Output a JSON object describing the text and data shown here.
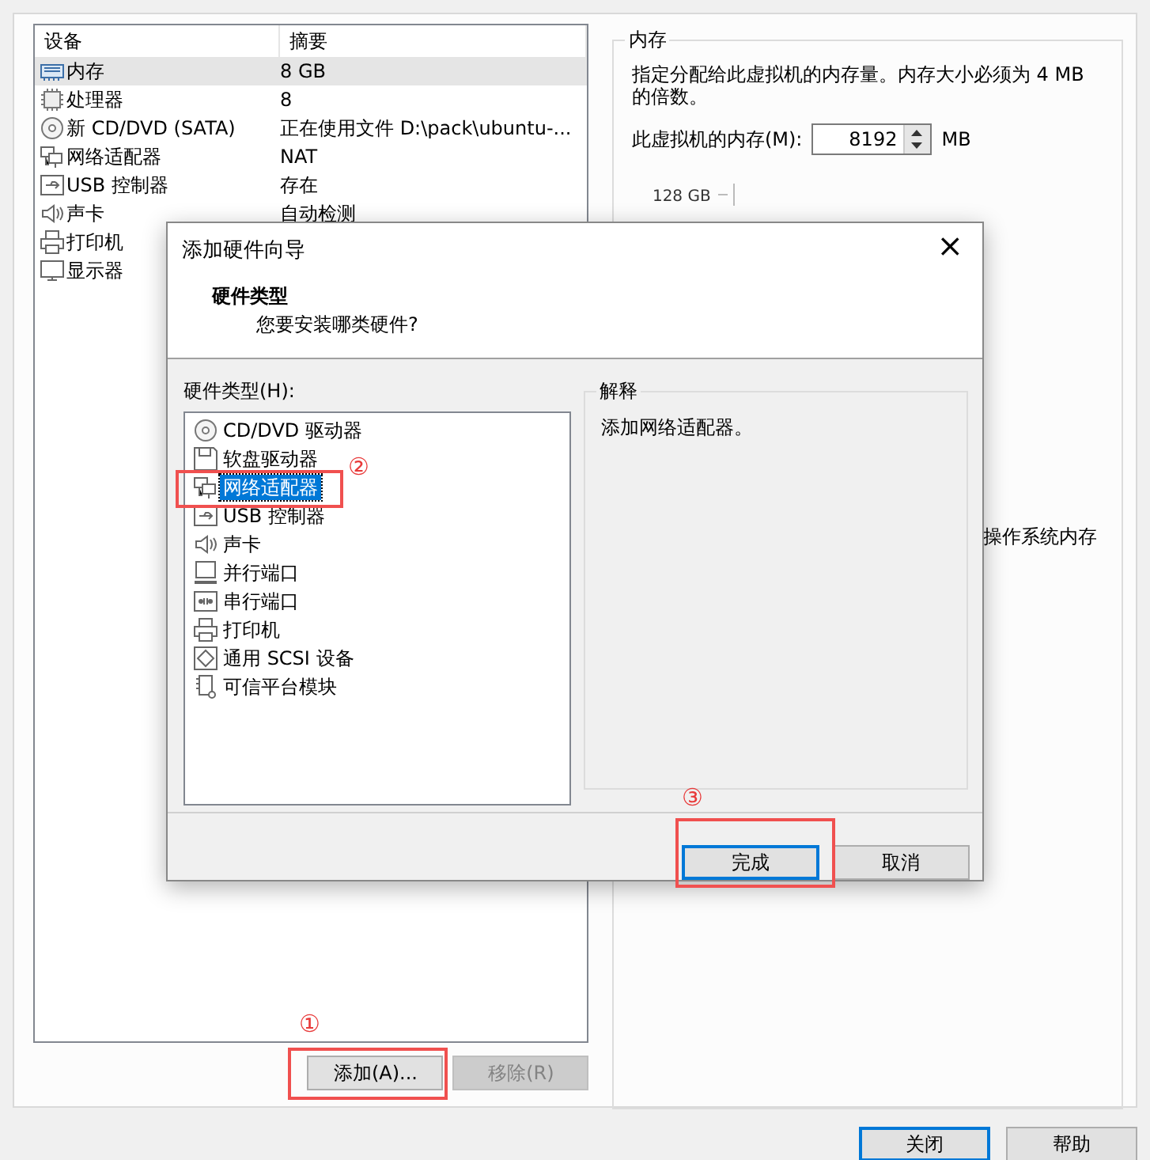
{
  "devices": {
    "columns": [
      "设备",
      "摘要"
    ],
    "rows": [
      {
        "kind": "memory",
        "name": "内存",
        "summary": "8 GB",
        "selected": true
      },
      {
        "kind": "cpu",
        "name": "处理器",
        "summary": "8",
        "selected": false
      },
      {
        "kind": "disc",
        "name": "新 CD/DVD (SATA)",
        "summary": "正在使用文件 D:\\pack\\ubuntu-...",
        "selected": false
      },
      {
        "kind": "network",
        "name": "网络适配器",
        "summary": "NAT",
        "selected": false
      },
      {
        "kind": "usb",
        "name": "USB 控制器",
        "summary": "存在",
        "selected": false
      },
      {
        "kind": "sound",
        "name": "声卡",
        "summary": "自动检测",
        "selected": false
      },
      {
        "kind": "printer",
        "name": "打印机",
        "selected": false
      },
      {
        "kind": "display",
        "name": "显示器",
        "selected": false
      }
    ]
  },
  "device_buttons": [
    {
      "label": "添加(A)...",
      "disabled": false
    },
    {
      "label": "移除(R)",
      "disabled": true
    }
  ],
  "memory": {
    "title": "内存",
    "description": "指定分配给此虚拟机的内存量。内存大小必须为 4 MB 的倍数。",
    "field_label": "此虚拟机的内存(M):",
    "value": "8192",
    "unit": "MB",
    "scale_label": "128 GB",
    "note": "操作系统内存"
  },
  "footer_buttons": [
    {
      "label": "关闭",
      "default": true
    },
    {
      "label": "帮助",
      "default": false
    }
  ],
  "dialog": {
    "title": "添加硬件向导",
    "close": "×",
    "heading": "硬件类型",
    "subheading": "您要安装哪类硬件?",
    "list_label": "硬件类型(H):",
    "items": [
      {
        "kind": "disc",
        "label": "CD/DVD 驱动器",
        "selected": false
      },
      {
        "kind": "floppy",
        "label": "软盘驱动器",
        "selected": false
      },
      {
        "kind": "network",
        "label": "网络适配器",
        "selected": true
      },
      {
        "kind": "usb",
        "label": "USB 控制器",
        "selected": false
      },
      {
        "kind": "sound",
        "label": "声卡",
        "selected": false
      },
      {
        "kind": "parallel",
        "label": "并行端口",
        "selected": false
      },
      {
        "kind": "serial",
        "label": "串行端口",
        "selected": false
      },
      {
        "kind": "printer",
        "label": "打印机",
        "selected": false
      },
      {
        "kind": "scsi",
        "label": "通用 SCSI 设备",
        "selected": false
      },
      {
        "kind": "tpm",
        "label": "可信平台模块",
        "selected": false
      }
    ],
    "explanation_title": "解释",
    "explanation": "添加网络适配器。",
    "buttons": [
      {
        "label": "完成",
        "default": true
      },
      {
        "label": "取消",
        "default": false
      }
    ]
  },
  "annotations": [
    {
      "kind": "add",
      "number": "①"
    },
    {
      "kind": "item",
      "number": "②"
    },
    {
      "kind": "finish",
      "number": "③"
    }
  ]
}
